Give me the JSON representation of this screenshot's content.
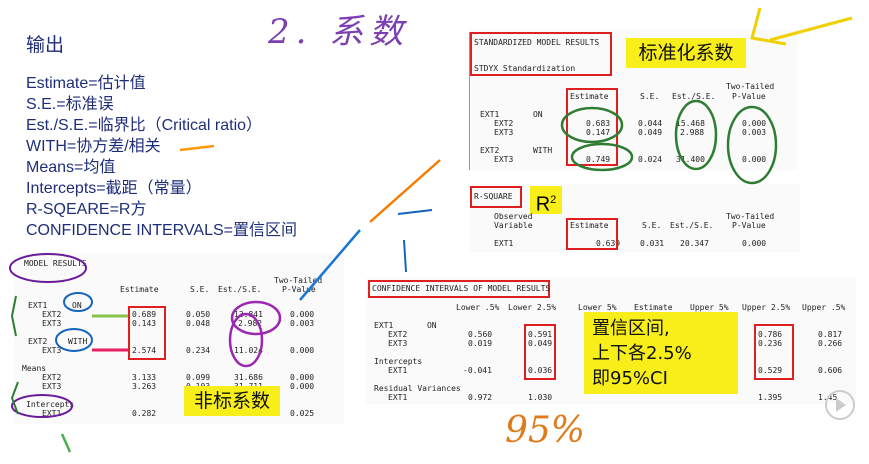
{
  "slide": {
    "title": "输出",
    "legend": [
      "Estimate=估计值",
      "S.E.=标准误",
      "Est./S.E.=临界比（Critical ratio）",
      "WITH=协方差/相关",
      "Means=均值",
      "Intercepts=截距（常量）",
      "R-SQEARE=R方",
      "CONFIDENCE INTERVALS=置信区间"
    ],
    "handwriting": {
      "top": "2. 系数",
      "bottom": "95%"
    }
  },
  "std_results": {
    "header": "STANDARDIZED MODEL RESULTS",
    "subheader": "STDYX Standardization",
    "col_tt": "Two-Tailed",
    "cols": [
      "Estimate",
      "S.E.",
      "Est./S.E.",
      "P-Value"
    ],
    "groups": [
      {
        "label": "EXT1       ON",
        "rows": [
          {
            "name": "EXT2",
            "est": "0.683",
            "se": "0.044",
            "cr": "15.468",
            "p": "0.000"
          },
          {
            "name": "EXT3",
            "est": "0.147",
            "se": "0.049",
            "cr": "2.988",
            "p": "0.003"
          }
        ]
      },
      {
        "label": "EXT2       WITH",
        "rows": [
          {
            "name": "EXT3",
            "est": "0.749",
            "se": "0.024",
            "cr": "31.400",
            "p": "0.000"
          }
        ]
      }
    ],
    "callout": "标准化系数"
  },
  "rsquare": {
    "header": "R-SQUARE",
    "symbol": "R",
    "symbol_sup": "2",
    "col_tt": "Two-Tailed",
    "col_var": "Observed",
    "col_var2": "Variable",
    "cols": [
      "Estimate",
      "S.E.",
      "Est./S.E.",
      "P-Value"
    ],
    "row": {
      "name": "EXT1",
      "est": "0.639",
      "se": "0.031",
      "cr": "20.347",
      "p": "0.000"
    }
  },
  "model_results": {
    "header": "MODEL RESULTS",
    "col_tt": "Two-Tailed",
    "cols": [
      "Estimate",
      "S.E.",
      "Est./S.E.",
      "P-Value"
    ],
    "on_label": "EXT1",
    "on_kw": "ON",
    "on_rows": [
      {
        "name": "EXT2",
        "est": "0.689",
        "se": "0.050",
        "cr": "13.841",
        "p": "0.000"
      },
      {
        "name": "EXT3",
        "est": "0.143",
        "se": "0.048",
        "cr": "2.982",
        "p": "0.003"
      }
    ],
    "with_label": "EXT2",
    "with_kw": "WITH",
    "with_rows": [
      {
        "name": "EXT3",
        "est": "2.574",
        "se": "0.234",
        "cr": "11.024",
        "p": "0.000"
      }
    ],
    "means_label": "Means",
    "means_rows": [
      {
        "name": "EXT2",
        "est": "3.133",
        "se": "0.099",
        "cr": "31.686",
        "p": "0.000"
      },
      {
        "name": "EXT3",
        "est": "3.263",
        "se": "0.103",
        "cr": "31.711",
        "p": "0.000"
      }
    ],
    "int_label": "Intercepts",
    "int_rows": [
      {
        "name": "EXT1",
        "est": "0.282",
        "se": "",
        "cr": "",
        "p": "0.025"
      }
    ],
    "callout": "非标系数"
  },
  "ci": {
    "header": "CONFIDENCE INTERVALS OF MODEL RESULTS",
    "cols": [
      "Lower .5%",
      "Lower 2.5%",
      "Lower 5%",
      "Estimate",
      "Upper 5%",
      "Upper 2.5%",
      "Upper .5%"
    ],
    "on_label": "EXT1       ON",
    "rows_on": [
      {
        "name": "EXT2",
        "l05": "0.560",
        "l25": "0.591",
        "u25": "0.786",
        "u05": "0.817"
      },
      {
        "name": "EXT3",
        "l05": "0.019",
        "l25": "0.049",
        "u25": "0.236",
        "u05": "0.266"
      }
    ],
    "int_label": "Intercepts",
    "rows_int": [
      {
        "name": "EXT1",
        "l05": "-0.041",
        "l25": "0.036",
        "u25": "0.529",
        "u05": "0.606"
      }
    ],
    "res_label": "Residual Variances",
    "rows_res": [
      {
        "name": "EXT1",
        "l05": "0.972",
        "l25": "1.030",
        "u25": "1.395",
        "u05": "1.45"
      }
    ],
    "callout_lines": [
      "置信区间,",
      "上下各2.5%",
      "即95%CI"
    ]
  },
  "colors": {
    "red": "#e02020",
    "yellow": "#f7ee1a",
    "navy": "#1f2e7a"
  }
}
